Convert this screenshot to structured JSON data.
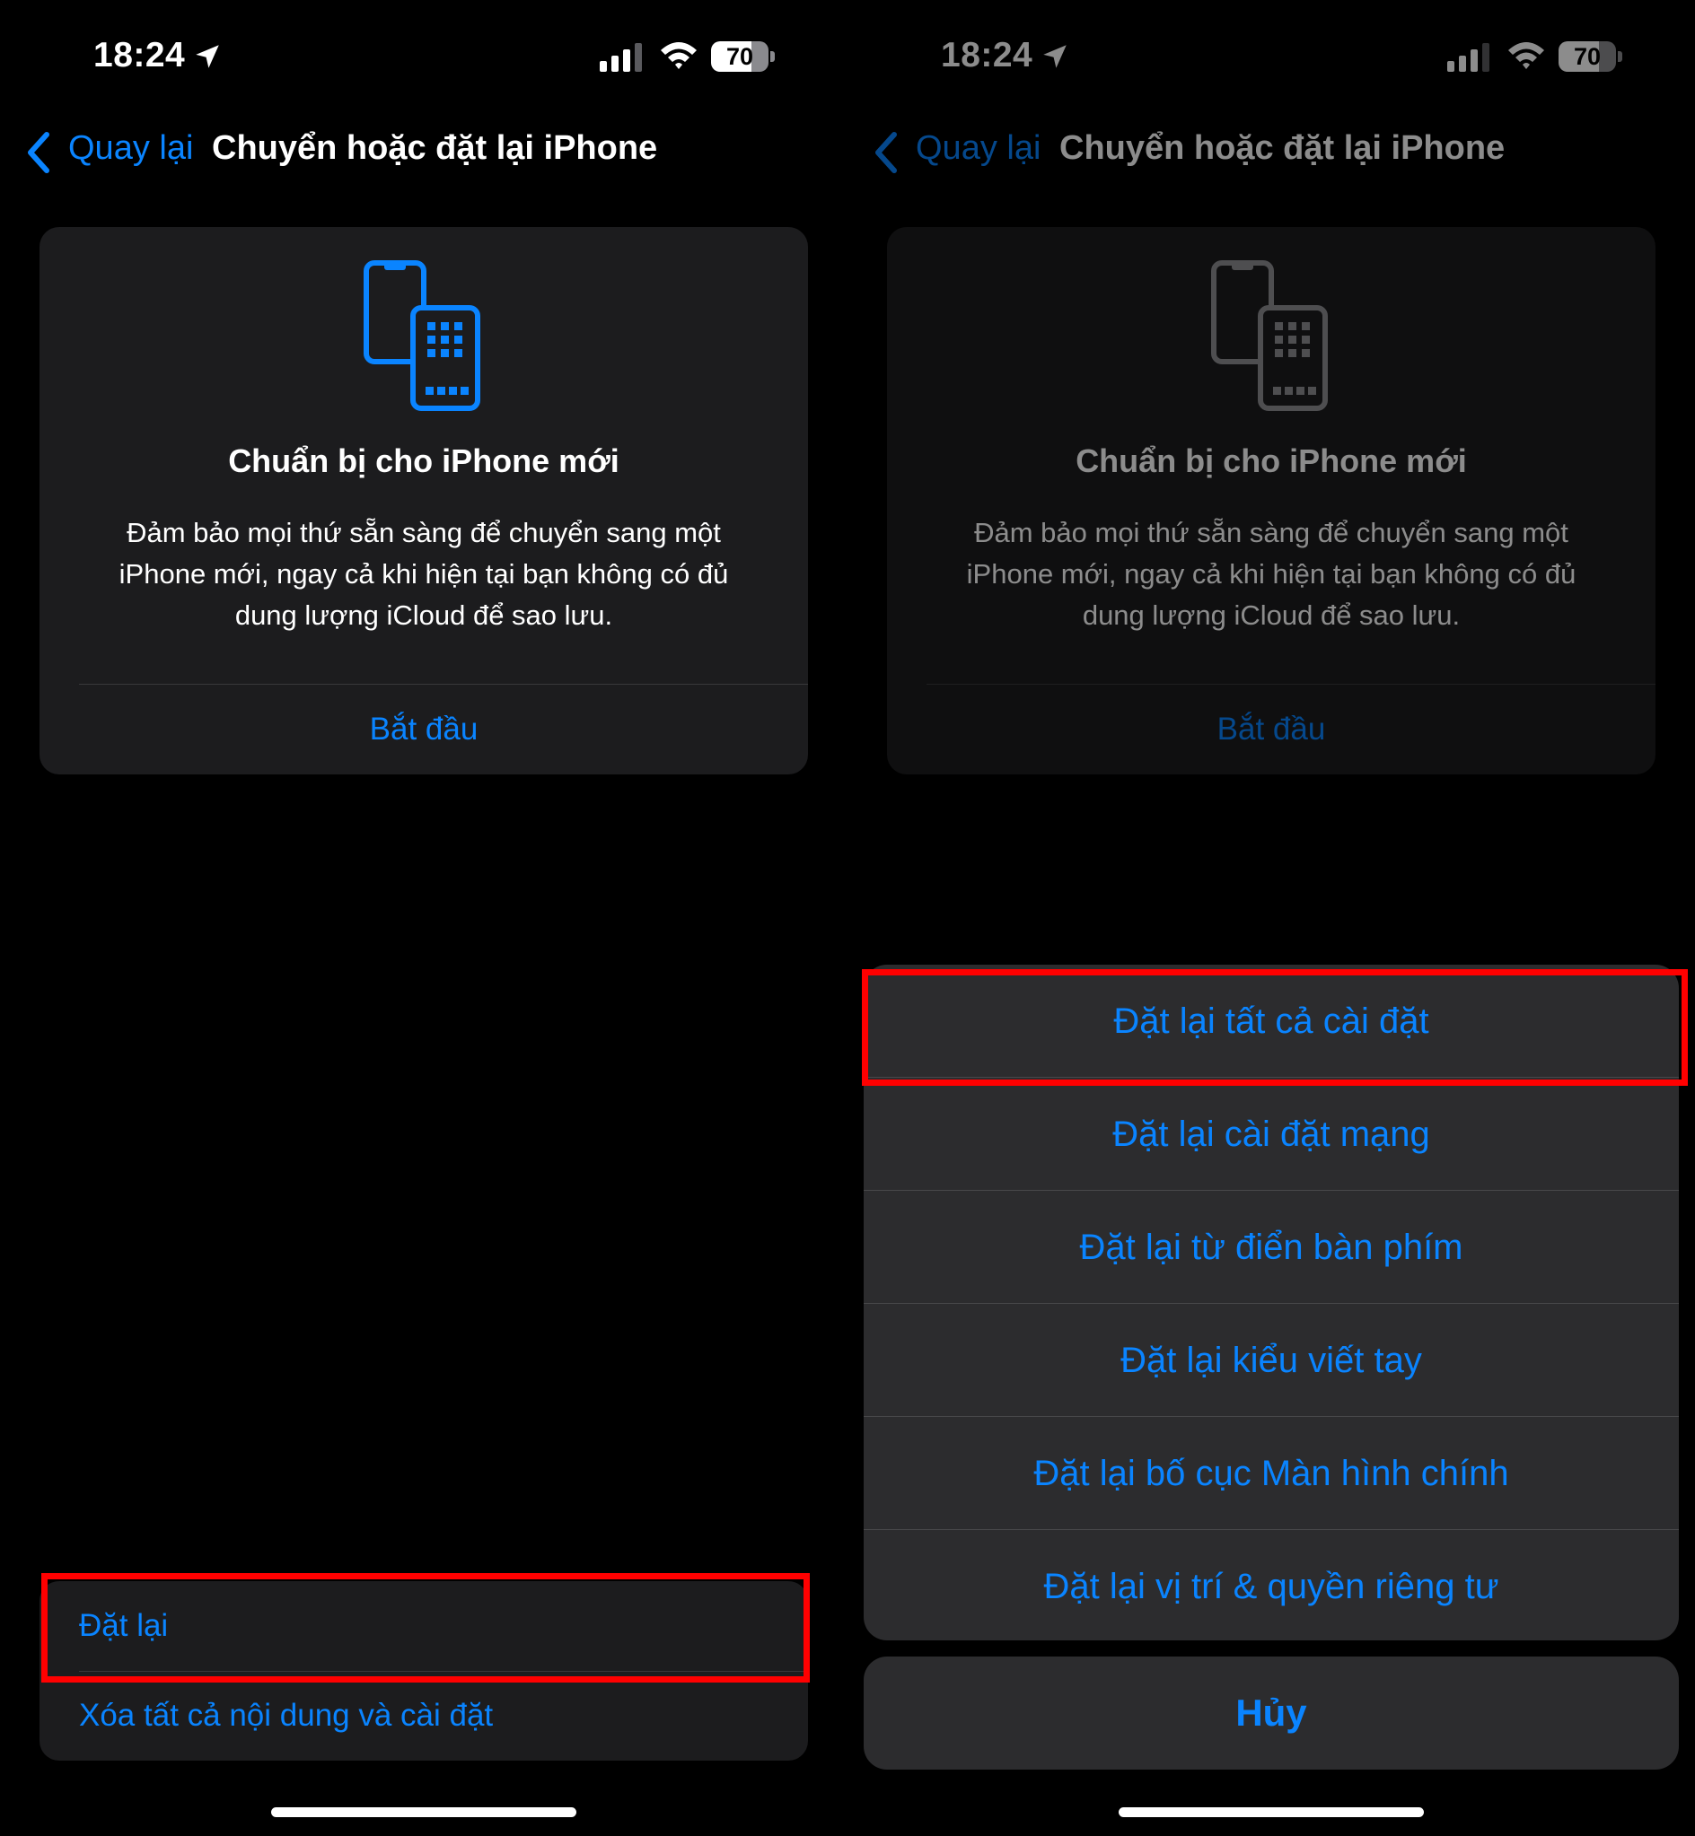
{
  "status_bar": {
    "time": "18:24",
    "battery": "70",
    "battery_level_percent": 70
  },
  "nav": {
    "back_label": "Quay lại",
    "title": "Chuyển hoặc đặt lại iPhone"
  },
  "card": {
    "title": "Chuẩn bị cho iPhone mới",
    "description": "Đảm bảo mọi thứ sẵn sàng để chuyển sang một iPhone mới, ngay cả khi hiện tại bạn không có đủ dung lượng iCloud để sao lưu.",
    "action_label": "Bắt đầu"
  },
  "bottom_list": {
    "reset_label": "Đặt lại",
    "erase_label": "Xóa tất cả nội dung và cài đặt"
  },
  "action_sheet": {
    "items": [
      "Đặt lại tất cả cài đặt",
      "Đặt lại cài đặt mạng",
      "Đặt lại từ điển bàn phím",
      "Đặt lại kiểu viết tay",
      "Đặt lại bố cục Màn hình chính",
      "Đặt lại vị trí & quyền riêng tư"
    ],
    "cancel_label": "Hủy"
  },
  "colors": {
    "accent": "#0a84ff",
    "highlight": "#ff0000",
    "card_bg": "#1c1c1e",
    "sheet_bg": "#2c2c2e"
  },
  "icons": [
    "location-arrow-icon",
    "cellular-signal-icon",
    "wifi-icon",
    "battery-icon",
    "chevron-left-icon",
    "two-phones-icon"
  ]
}
